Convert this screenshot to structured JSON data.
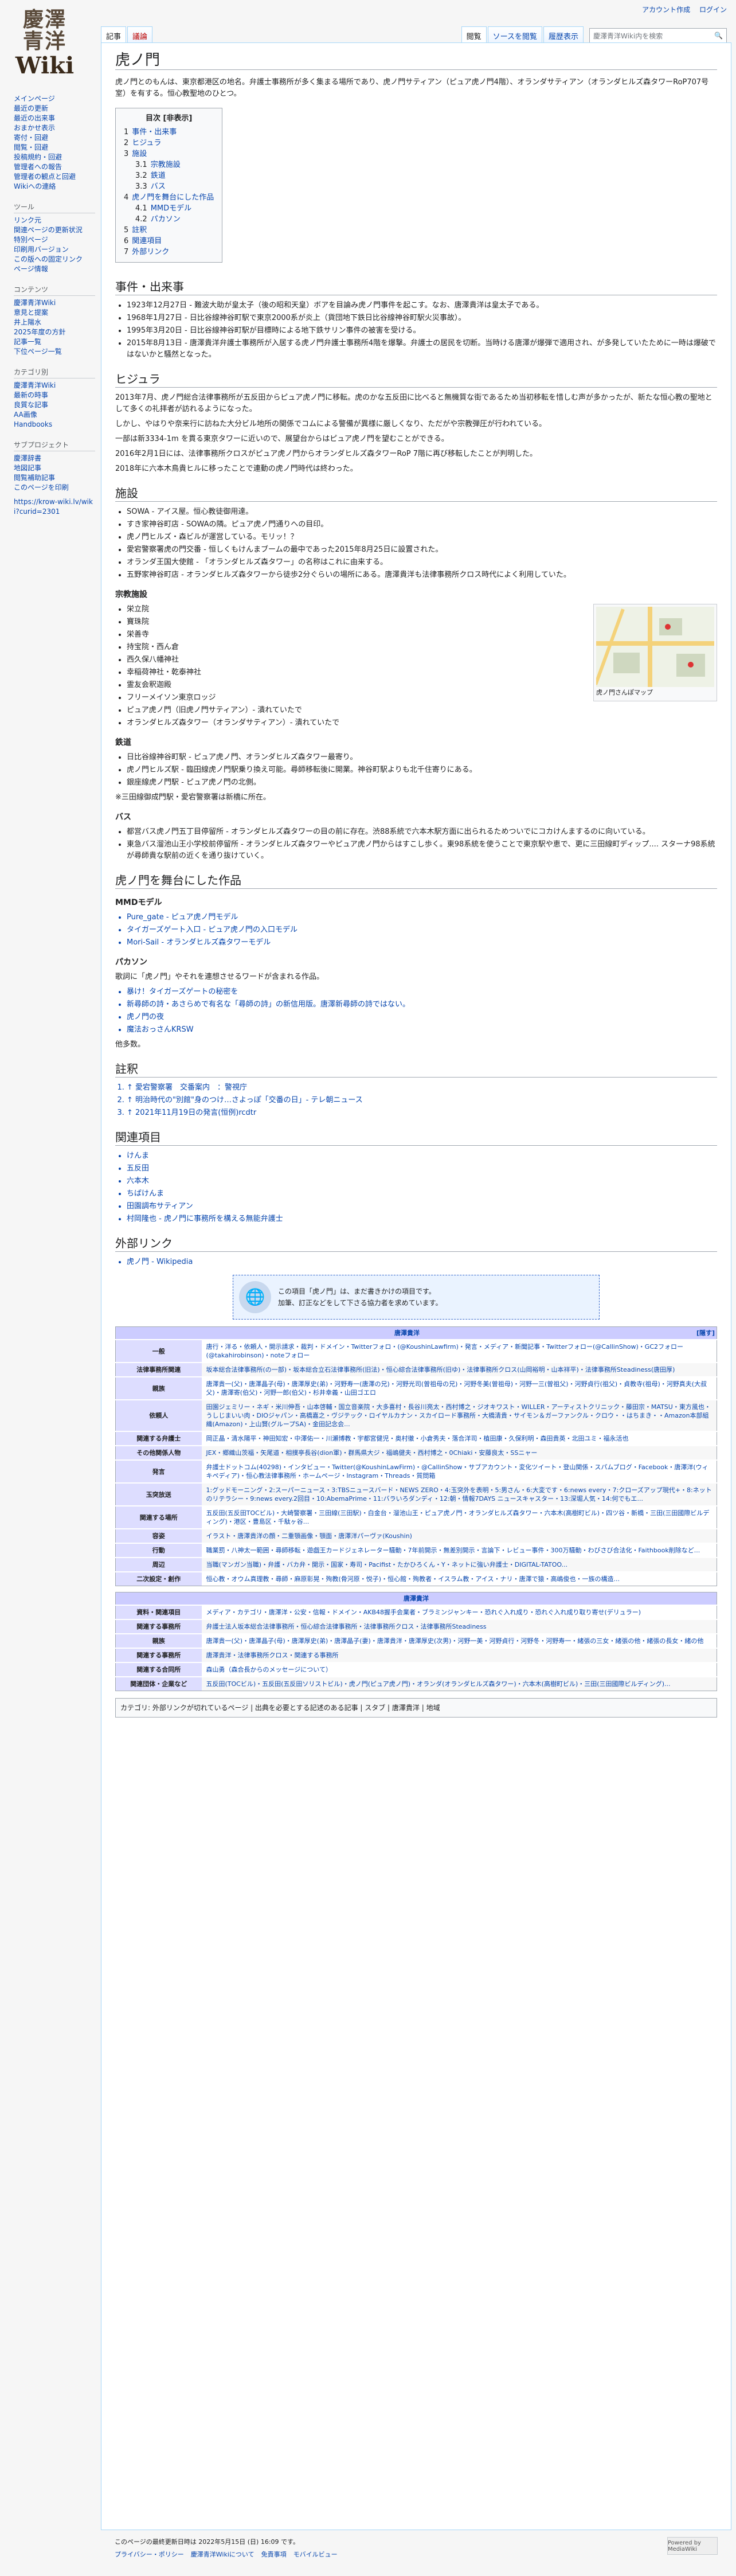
{
  "site": {
    "logo_line1": "慶澤",
    "logo_line2": "青洋",
    "logo_line3": "Wiki"
  },
  "personal": {
    "account": "アカウント作成",
    "login": "ログイン"
  },
  "tabs": {
    "page": "記事",
    "talk": "議論",
    "read": "閲覧",
    "edit": "ソースを閲覧",
    "history": "履歴表示"
  },
  "search": {
    "placeholder": "慶澤青洋Wiki内を検索"
  },
  "sidebar": {
    "nav": [
      "メインページ",
      "最近の更新",
      "最近の出来事",
      "おまかせ表示",
      "寄付・回避",
      "閲覧・回避",
      "投稿規約・回避",
      "管理者への報告",
      "管理者の観点と回避",
      "Wikiへの連絡"
    ],
    "tools_head": "ツール",
    "tools": [
      "リンク元",
      "関連ページの更新状況",
      "特別ページ",
      "印刷用バージョン",
      "この版への固定リンク",
      "ページ情報"
    ],
    "links_head": "コンテンツ",
    "links": [
      "慶澤青洋Wiki",
      "意見と提案",
      "井上陽水",
      "2025年度の方針",
      "記事一覧",
      "下位ページ一覧"
    ],
    "cat_head": "カテゴリ別",
    "cats": [
      "慶澤青洋Wiki",
      "最新の時事",
      "良質な記事",
      "AA画像",
      "Handbooks"
    ],
    "sub_head": "サブプロジェクト",
    "subs": [
      "慶澤辞書",
      "地図記事",
      "閲覧補助記事",
      "このページを印刷"
    ],
    "extra": "https://krow-wiki.lv/wiki?curid=2301"
  },
  "article": {
    "title": "虎ノ門",
    "intro": "虎ノ門とのもんは、東京都港区の地名。弁護士事務所が多く集まる場所であり、虎ノ門サティアン（ピュア虎ノ門4階）、オランダサティアン（オランダヒルズ森タワーRoP707号室）を有する。恒心教聖地のひとつ。",
    "toc_title": "目次 [非表示]",
    "toc": [
      {
        "n": "1",
        "t": "事件・出来事",
        "l": 1
      },
      {
        "n": "2",
        "t": "ヒジュラ",
        "l": 1
      },
      {
        "n": "3",
        "t": "施設",
        "l": 1
      },
      {
        "n": "3.1",
        "t": "宗教施設",
        "l": 2
      },
      {
        "n": "3.2",
        "t": "鉄道",
        "l": 2
      },
      {
        "n": "3.3",
        "t": "バス",
        "l": 2
      },
      {
        "n": "4",
        "t": "虎ノ門を舞台にした作品",
        "l": 1
      },
      {
        "n": "4.1",
        "t": "MMDモデル",
        "l": 2
      },
      {
        "n": "4.2",
        "t": "パカソン",
        "l": 2
      },
      {
        "n": "5",
        "t": "註釈",
        "l": 1
      },
      {
        "n": "6",
        "t": "関連項目",
        "l": 1
      },
      {
        "n": "7",
        "t": "外部リンク",
        "l": 1
      }
    ],
    "h_events": "事件・出来事",
    "events": [
      "1923年12月27日 - 難波大助が皇太子（後の昭和天皇）ボアを目論み虎ノ門事件を起こす。なお、唐澤貴洋は皇太子である。",
      "1968年1月27日 - 日比谷線神谷町駅で東京2000系が炎上（貨団地下鉄日比谷線神谷町駅火災事故）。",
      "1995年3月20日 - 日比谷線神谷町駅が目標時による地下鉄サリン事件の被害を受ける。",
      "2015年8月13日 - 唐澤貴洋弁護士事務所が入居する虎ノ門弁護士事務所4階を爆撃。弁護士の居民を切断。当時ける唐澤が爆弾で適用され、が多発していたために一時は爆破ではないかと騒然となった。"
    ],
    "h_hijra": "ヒジュラ",
    "hijra": [
      "2013年7月、虎ノ門総合法律事務所が五反田からピュア虎ノ門に移転。虎のかな五反田に比べると無機質な街であるため当初移転を惜しむ声が多かったが、新たな恒心教の聖地として多くの礼拝者が訪れるようになった。",
      "しかし、やはりや奈来行に訪ねた大分ビル地所の関係でコムによる警備が異様に厳しくなり、ただがや宗教弾圧が行われている。",
      "一部は新3334-1m を貫る東京タワーに近いので、展望台からはピュア虎ノ門を望むことができる。",
      "2016年2月1日には、法律事務所クロスがピュア虎ノ門からオランダヒルズ森タワーRoP 7階に再び移転したことが判明した。",
      "2018年に六本木鳥貴ヒルに移ったことで連動の虎ノ門時代は終わった。"
    ],
    "h_facilities": "施設",
    "facilities": [
      "SOWA - アイス屋。恒心教徒御用達。",
      "すき家神谷町店 - SOWAの隣。ピュア虎ノ門通りへの目印。",
      "虎ノ門ヒルズ・森ビルが運営している。モリッ！？",
      "愛宕警察署虎の門交番 - 恒しくもけんまブームの最中であった2015年8月25日に設置された。",
      "オランダ王国大使館 - 「オランダヒルズ森タワー」の名称はこれに由来する。",
      "五野家神谷町店 - オランダヒルズ森タワーから徒歩2分ぐらいの場所にある。唐澤貴洋も法律事務所クロス時代によく利用していた。"
    ],
    "h_religion": "宗教施設",
    "religion": [
      "栄立院",
      "寶珠院",
      "栄善寺",
      "持宝院・西ん倉",
      "西久保八幡神社",
      "幸稲荷神社・乾泰神社",
      "霊友会釈迦殿",
      "フリーメイソン東京ロッジ",
      "ピュア虎ノ門（旧虎ノ門サティアン）- 潰れていたで",
      "オランダヒルズ森タワー（オランダサティアン）- 潰れていたで"
    ],
    "map_caption": "虎ノ門さんぽマップ",
    "h_rail": "鉄道",
    "rail": [
      "日比谷線神谷町駅 - ピュア虎ノ門、オランダヒルズ森タワー最寄り。",
      "虎ノ門ヒルズ駅 - 臨田線虎ノ門駅乗り換え可能。尋師移転後に開業。神谷町駅よりも北千住寄りにある。",
      "銀座線虎ノ門駅 - ピュア虎ノ門の北側。"
    ],
    "rail_note": "※三田線御成門駅・愛宕警察署は新橋に所在。",
    "h_bus": "バス",
    "bus": [
      "都営バス虎ノ門五丁目停留所 - オランダヒルズ森タワーの目の前に存在。渋88系統で六本木駅方面に出られるためついでにコカけんまするのに向いている。",
      "東急バス溜池山王小学校前停留所 - オランダヒルズ森タワーやピュア虎ノ門からはすこし歩く。東98系統を使うことで東京駅や恵で、更に三田線町ディップ.... スターナ98系統が尋師貴な駅前の近くを通り抜けていく。"
    ],
    "h_works": "虎ノ門を舞台にした作品",
    "h_mmd": "MMDモデル",
    "mmd": [
      "Pure_gate - ピュア虎ノ門モデル",
      "タイガーズゲート入口 - ピュア虎ノ門の入口モデル",
      "Mori-Sail - オランダヒルズ森タワーモデル"
    ],
    "h_pakason": "パカソン",
    "pakason_intro": "歌詞に「虎ノ門」やそれを連想させるワードが含まれる作品。",
    "pakason": [
      "暴け！タイガーズゲートの秘密を",
      "新尋師の詩・あさらめで有名な「尋師の詩」の新信用版。唐澤新尋師の詩ではない。",
      "虎ノ門の夜",
      "魔法おっさんKRSW"
    ],
    "pakason_more": "他多数。",
    "h_notes": "註釈",
    "notes": [
      "↑ 愛宕警察署　交番案内　：警視庁",
      "↑ 明治時代の\"別館\"身のつけ…さよっぽ「交番の日」- テレ朝ニュース",
      "↑ 2021年11月19日の発言(恒例)rcdtr"
    ],
    "h_related": "関連項目",
    "related": [
      "けんま",
      "五反田",
      "六本木",
      "ちばけんま",
      "田園調布サティアン",
      "村岡隆也 - 虎ノ門に事務所を構える無能弁護士"
    ],
    "h_ext": "外部リンク",
    "ext": [
      "虎ノ門 - Wikipedia"
    ],
    "stub_line1": "この項目「虎ノ門」は、まだ書きかけの項目です。",
    "stub_line2": "加筆、訂正などをして下さる協力者を求めています。",
    "navbox_title": "唐澤貴洋",
    "navbox_toggle": "[隠す]",
    "navbox": [
      {
        "g": "一般",
        "l": "唐行・洋る・依頼人・開示請求・裁判・ドメイン・Twitterフォロ・(@KoushinLawfirm)・発言・メディア・新聞記事・Twitterフォロー(@CallinShow)・GC2フォロー(@takahirobinson)・noteフォロー"
      },
      {
        "g": "法律事務所関連",
        "l": "坂本総合法律事務所(の一部)・坂本総合立石法律事務所(旧法)・恒心綜合法律事務所(旧ゆ)・法律事務所クロス(山岡裕明・山本祥平)・法律事務所Steadiness(唐田厚)"
      },
      {
        "g": "親族",
        "l": "唐澤貴一(父)・唐澤晶子(母)・唐澤厚史(弟)・河野寿一(唐澤の兄)・河野光司(曽祖母の兄)・河野冬美(曽祖母)・河野一三(曽祖父)・河野貞行(祖父)・貞教寺(祖母)・河野真夫(大叔父)・唐澤寄(伯父)・河野一郎(伯父)・杉井幸義・山田ゴエロ"
      },
      {
        "g": "依頼人",
        "l": "田園ジェミリー・ネギ・米川伸吾・山本啓輔・国立音楽院・大多喜村・長谷川亮太・西村博之・ジオキワスト・WILLER・アーティストクリニック・藤田宗・MATSU・東方風也・うしじまいい肉・DIOジャパン・高橋嘉之・ヴジテック・ロイヤルカナン・スカイロード事務所・大橋清貴・サイモン＆ガーファンクル・クロウ・・はちまき・・Amazon本部組織(Amazon)・上山賢(グループSA)・金田記念会..."
      },
      {
        "g": "関連する弁護士",
        "l": "岡正晶・清水陽平・神田知宏・中澤佑一・川瀬博教・宇都宮健児・奥村徹・小倉秀夫・落合洋司・植田康・久保利明・森田貴英・北田ユミ・福永活也"
      },
      {
        "g": "その他関係人物",
        "l": "JEX・郷織山茨福・矢尾道・相撲亭長谷(dion軍)・群馬県大ジ・福嶋健夫・西村博之・0Chiaki・安藤良太・SSニャー"
      },
      {
        "g": "発言",
        "l": "弁護士ドットコム(40298)・インタビュー・Twitter(@KoushinLawFirm)・@CallinShow・サブアカウント・変化ツイート・登山関係・スパムブログ・Facebook・唐澤洋(ウィキペディア)・恒心教法律事務所・ホームページ・lnstagram・Threads・質問箱"
      },
      {
        "g": "玉突放送",
        "l": "1:グッドモーニング・2:スーパーニュース・3:TBSニュースバード・NEWS ZERO・4:玉突外を表明・5:男さん・6:大変です・6:news every・7:クローズアップ現代+・8:ネットのリテラシー・9:news every.2回目・10:AbemaPrime・11:バラいろダンディ・12:朝・情報7DAYS ニュースキャスター・13:深堀人気・14:何でもエ..."
      },
      {
        "g": "関連する場所",
        "l": "五反田(五反田TOCビル)・大崎警察署・三田線(三田駅)・白金台・溜池山王・ピュア虎ノ門・オランダヒルズ森タワー・六本木(高樹町ビル)・四ツ谷・新橋・三田(三田國際ビルディング)・港区・豊島区・千駄ヶ谷..."
      },
      {
        "g": "容姿",
        "l": "イラスト・唐澤貴洋の顔・二重顎画像・顎面・唐澤洋パーヴァ(Koushin)"
      },
      {
        "g": "行動",
        "l": "職業罰・八神太一範囲・尋師移転・遊戯王カードジェネレーター騒動・7年前開示・無差別開示・言論下・レビュー事件・300万騒動・わびさび合法化・Faithbook削除など..."
      },
      {
        "g": "周辺",
        "l": "当職(マンガン当職)・弁護・バカ弁・開示・国家・寿司・Pacifist・たかひろくん・Y・ネットに強い弁護士・DIGITAL-TATOO..."
      },
      {
        "g": "二次設定・創作",
        "l": "恒心教・オウム真理教・尋師・麻原彰晃・殉教(骨河原・悦子)・恒心館・殉教者・イスラム教・アイス・ナリ・唐澤で猿・高嶋俊也・一族の構造..."
      }
    ],
    "navbox2_title": "唐澤貴洋",
    "navbox2": [
      {
        "g": "資料・関連項目",
        "l": "メディア・カテゴリ・唐澤洋・公安・信報・ドメイン・AKB48握手会業者・ブラミンジャンキー・恐れぐ入れ成り・恐れぐ入れ成り取り寄せ(デリュラー)"
      },
      {
        "g": "関連する事務所",
        "l": "弁護士法人坂本総合法律事務所・恒心綜合法律事務所・法律事務所クロス・法律事務所Steadiness"
      },
      {
        "g": "親族",
        "l": "唐澤貴一(父)・唐澤晶子(母)・唐澤厚史(弟)・唐澤晶子(妻)・唐澤貴洋・唐澤厚史(次男)・河野一美・河野貞行・河野冬・河野寿一・緒張の三女・緒張の他・緒張の長女・緒の他"
      },
      {
        "g": "関連する事務所",
        "l": "唐澤貴洋・法律事務所クロス・関連する事務所"
      },
      {
        "g": "関連する合同所",
        "l": "森山勇（森合長からのメッセージについて）"
      },
      {
        "g": "関連団体・企業など",
        "l": "五反田(TOCビル)・五反田(五反田ソリストビル)・虎ノ門(ピュア虎ノ門)・オランダ(オランダヒルズ森タワー)・六本木(高樹町ビル)・三田(三田國際ビルディング)..."
      }
    ],
    "categories": "カテゴリ: 外部リンクが切れているページ | 出典を必要とする記述のある記事 | スタブ | 唐澤貴洋 | 地域",
    "footer_modified": "このページの最終更新日時は 2022年5月15日 (日) 16:09 です。",
    "footer_links": [
      "プライバシー・ポリシー",
      "慶澤青洋Wikiについて",
      "免責事項",
      "モバイルビュー"
    ],
    "badge1": "Powered by MediaWiki"
  }
}
